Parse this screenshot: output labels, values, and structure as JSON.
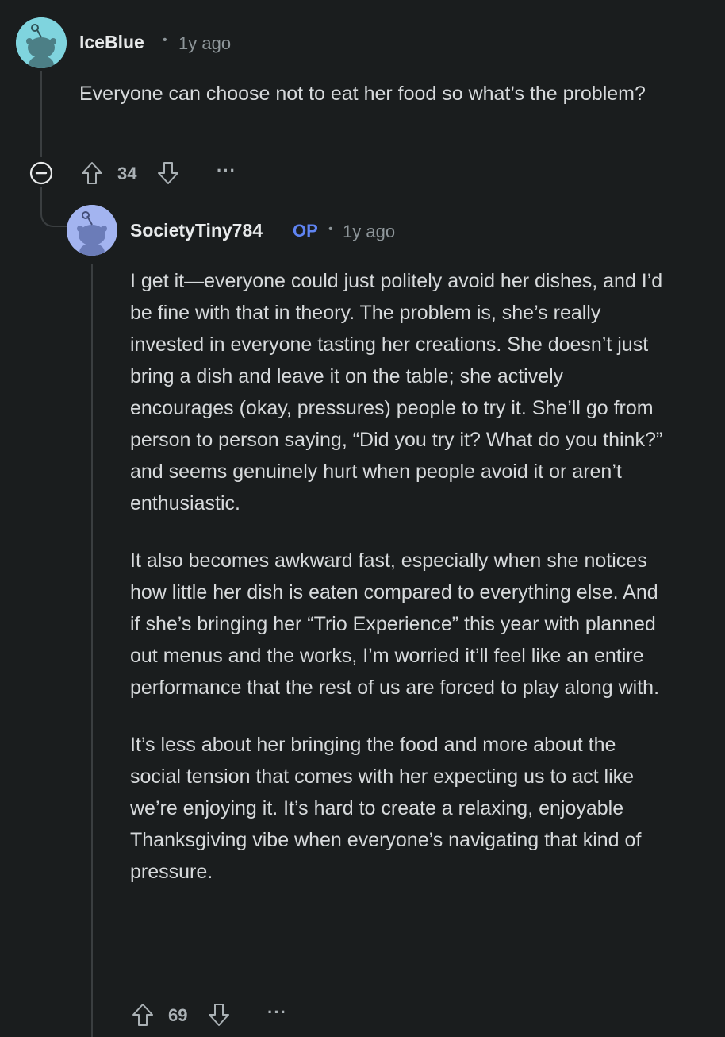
{
  "comments": [
    {
      "username": "IceBlue",
      "separator": "•",
      "time": "1y ago",
      "text": [
        "Everyone can choose not to eat her food so what’s the problem?"
      ],
      "votes": "34",
      "more": "···",
      "avatar_color": "#7fd4de"
    },
    {
      "username": "SocietyTiny784",
      "badge": "OP",
      "separator": "•",
      "time": "1y ago",
      "text": [
        "I get it—everyone could just politely avoid her dishes, and I’d be fine with that in theory. The problem is, she’s really invested in everyone tasting her creations. She doesn’t just bring a dish and leave it on the table; she actively encourages (okay, pressures) people to try it. She’ll go from person to person saying, “Did you try it? What do you think?” and seems genuinely hurt when people avoid it or aren’t enthusiastic.",
        "It also becomes awkward fast, especially when she notices how little her dish is eaten compared to everything else. And if she’s bringing her “Trio Experience” this year with planned out menus and the works, I’m worried it’ll feel like an entire performance that the rest of us are forced to play along with.",
        "It’s less about her bringing the food and more about the social tension that comes with her expecting us to act like we’re enjoying it. It’s hard to create a relaxing, enjoyable Thanksgiving vibe when everyone’s navigating that kind of pressure."
      ],
      "votes": "69",
      "more": "···",
      "avatar_color": "#a3b4f0"
    }
  ],
  "colors": {
    "background": "#1a1d1e",
    "text": "#d7dadc",
    "muted": "#8e969a",
    "op": "#5f84f2",
    "thread_line": "#3a3e40"
  }
}
